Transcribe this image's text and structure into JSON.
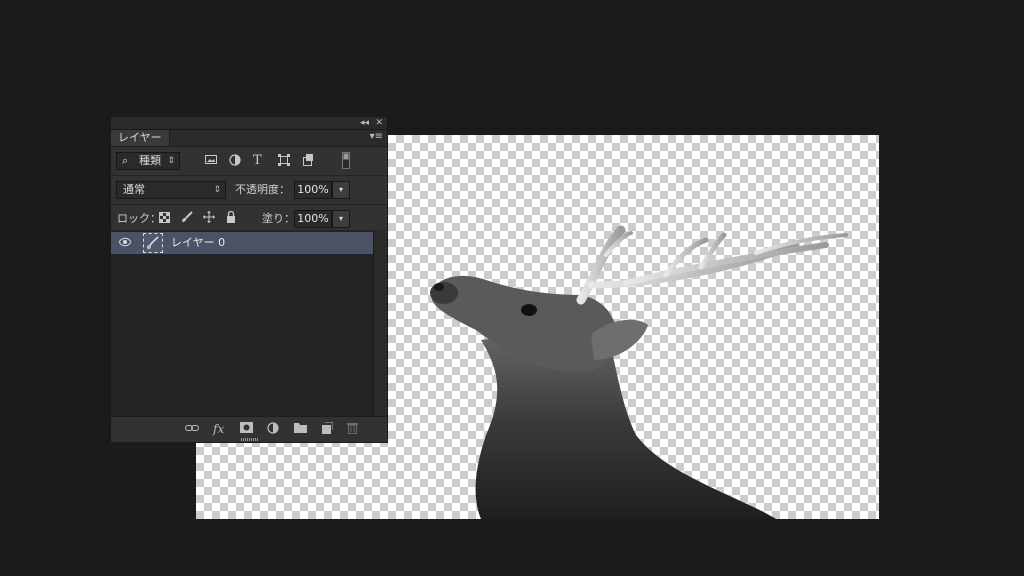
{
  "panel": {
    "collapse_icon": "◂◂",
    "close_icon": "✕",
    "tab_label": "レイヤー",
    "menu_icon": "▾≡",
    "filter": {
      "icon": "⌕",
      "label": "種類",
      "arrow": "⇕",
      "icons": [
        "image-filter-icon",
        "adjustment-filter-icon",
        "type-filter-icon",
        "shape-filter-icon",
        "smart-object-filter-icon",
        "filter-toggle-icon"
      ],
      "type_glyph": "T"
    },
    "blend": {
      "mode": "通常",
      "arrow": "⇕",
      "opacity_label": "不透明度：",
      "opacity_value": "100%",
      "dropdown_glyph": "▾"
    },
    "lock": {
      "label": "ロック：",
      "fill_label": "塗り：",
      "fill_value": "100%",
      "dropdown_glyph": "▾"
    },
    "layers": [
      {
        "name": "レイヤー 0",
        "visible": true,
        "selected": true
      }
    ],
    "footer_icons": [
      "link-icon",
      "fx-icon",
      "mask-icon",
      "adjustment-icon",
      "folder-icon",
      "new-layer-icon",
      "trash-icon"
    ],
    "fx_label": "fx"
  },
  "colors": {
    "background": "#1b1b1b",
    "panel": "#323232",
    "selected_layer": "#4a5366"
  }
}
